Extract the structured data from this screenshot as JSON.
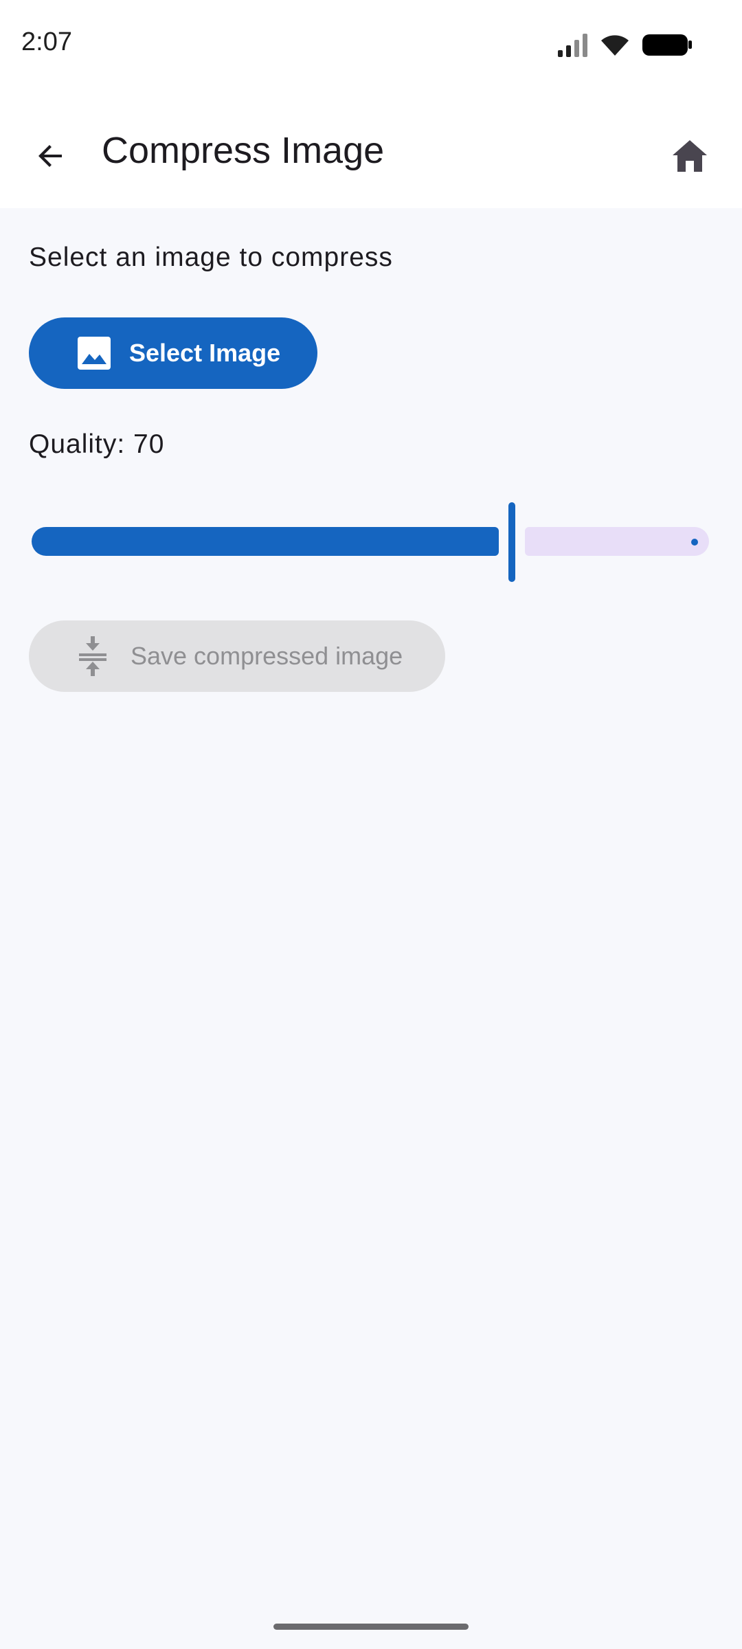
{
  "status_bar": {
    "time": "2:07",
    "icons": [
      "signal-icon",
      "wifi-icon",
      "battery-icon"
    ]
  },
  "app_bar": {
    "title": "Compress Image",
    "back_icon": "arrow-back-icon",
    "home_icon": "home-icon"
  },
  "main": {
    "prompt": "Select an image to compress",
    "select_button": {
      "label": "Select Image",
      "icon": "image-icon",
      "color": "#1565c0"
    },
    "quality": {
      "label": "Quality: 70",
      "value": 70,
      "min": 0,
      "max": 100
    },
    "save_button": {
      "label": "Save compressed image",
      "icon": "compress-icon",
      "enabled": false
    }
  },
  "colors": {
    "accent": "#1565c0",
    "inactive_track": "#e8def8",
    "background": "#f7f8fc"
  }
}
